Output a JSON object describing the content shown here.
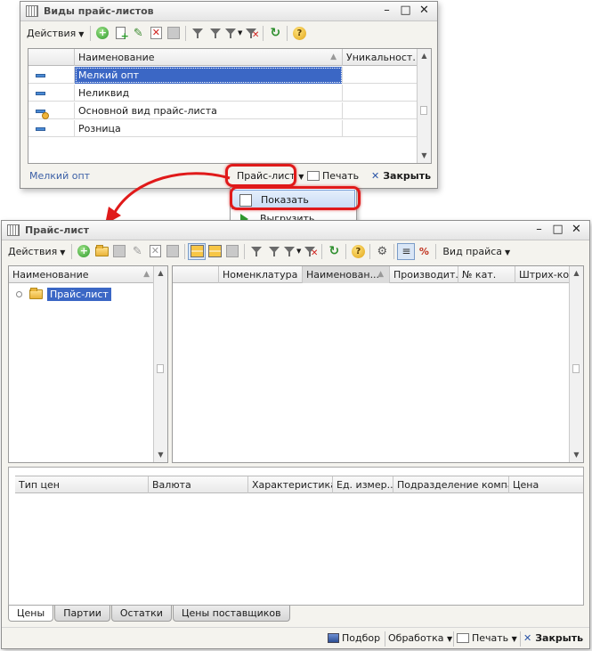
{
  "win1": {
    "title": "Виды прайс-листов",
    "toolbar": {
      "actions": "Действия"
    },
    "grid": {
      "headers": [
        "Наименование",
        "Уникальност..."
      ],
      "rows": [
        {
          "name": "Мелкий опт",
          "icon": "price-type-icon"
        },
        {
          "name": "Неликвид",
          "icon": "price-type-icon"
        },
        {
          "name": "Основной вид прайс-листа",
          "icon": "main-price-type-icon"
        },
        {
          "name": "Розница",
          "icon": "price-type-icon"
        }
      ]
    },
    "status_text": "Мелкий опт",
    "pricelist_btn": "Прайс-лист",
    "print_btn": "Печать",
    "close_btn": "Закрыть"
  },
  "dropdown": {
    "items": [
      "Показать",
      "Выгрузить"
    ]
  },
  "win2": {
    "title": "Прайс-лист",
    "toolbar": {
      "actions": "Действия",
      "view": "Вид прайса"
    },
    "tree": {
      "header": "Наименование",
      "root": "Прайс-лист"
    },
    "main_grid": {
      "headers": [
        "",
        "Номенклатура",
        "Наименован...",
        "Производит...",
        "№ кат.",
        "Штрих-код"
      ]
    },
    "bottom_grid": {
      "headers": [
        "Тип цен",
        "Валюта",
        "Характеристика",
        "Ед. измер...",
        "Подразделение компа...",
        "Цена"
      ]
    },
    "tabs": [
      "Цены",
      "Партии",
      "Остатки",
      "Цены поставщиков"
    ],
    "footer": {
      "select": "Подбор",
      "processing": "Обработка",
      "print": "Печать",
      "close": "Закрыть"
    }
  },
  "colors": {
    "selection": "#3b67c5",
    "highlight": "#e01a1a",
    "link": "#3b5fa6"
  }
}
